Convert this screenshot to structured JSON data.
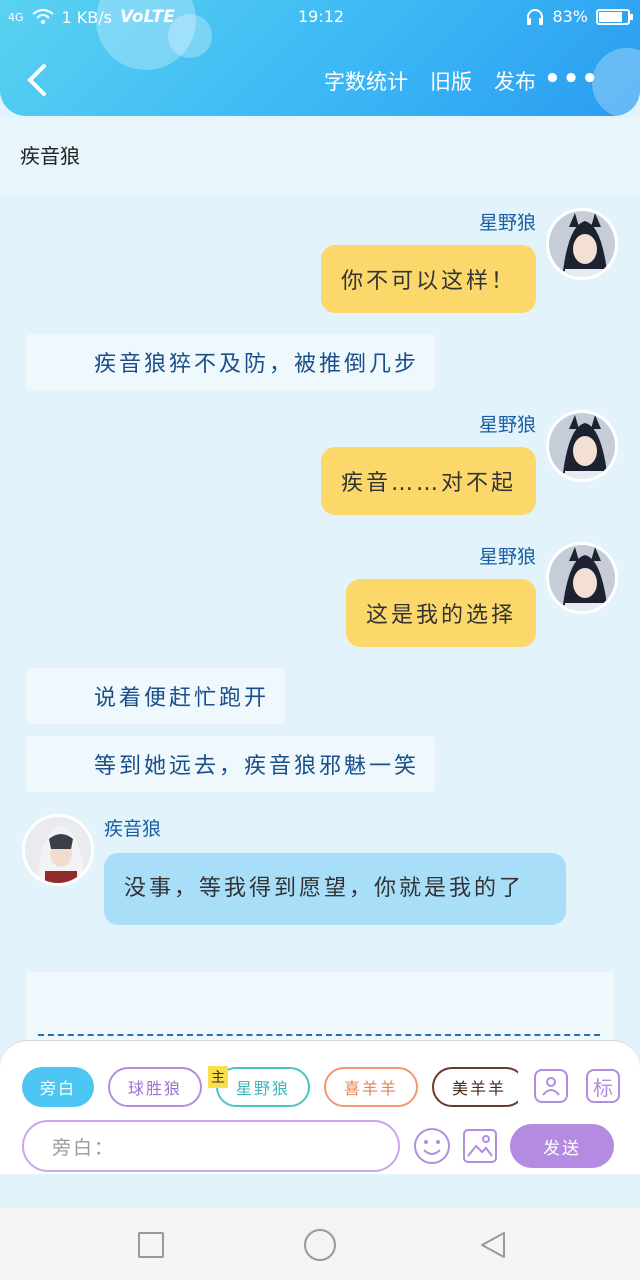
{
  "status_bar": {
    "signal": "4G",
    "speed": "1 KB/s",
    "network": "VoLTE",
    "time": "19:12",
    "battery": "83%",
    "battery_level": 0.83
  },
  "header": {
    "back_icon": "chevron-left-icon",
    "word_count": "字数统计",
    "old_version": "旧版",
    "publish": "发布",
    "more": "•••"
  },
  "chat_title": "疾音狼",
  "messages": [
    {
      "type": "right",
      "name": "星野狼",
      "text": "你不可以这样！"
    },
    {
      "type": "narration",
      "text": "疾音狼猝不及防，被推倒几步"
    },
    {
      "type": "right",
      "name": "星野狼",
      "text": "疾音……对不起"
    },
    {
      "type": "right",
      "name": "星野狼",
      "text": "这是我的选择"
    },
    {
      "type": "narration",
      "text": "说着便赶忙跑开"
    },
    {
      "type": "narration",
      "text": "等到她远去，疾音狼邪魅一笑"
    },
    {
      "type": "left",
      "name": "疾音狼",
      "text": "没事，等我得到愿望，你就是我的了"
    }
  ],
  "bottom": {
    "chips": [
      "旁白",
      "球胜狼",
      "星野狼",
      "喜羊羊",
      "美羊羊"
    ],
    "main_tag": "主",
    "input_placeholder": "旁白：",
    "send": "发送",
    "icon_tag_text": "标",
    "colors": {
      "accent": "#b48be0",
      "narration_chip": "#4ec6f3"
    }
  }
}
